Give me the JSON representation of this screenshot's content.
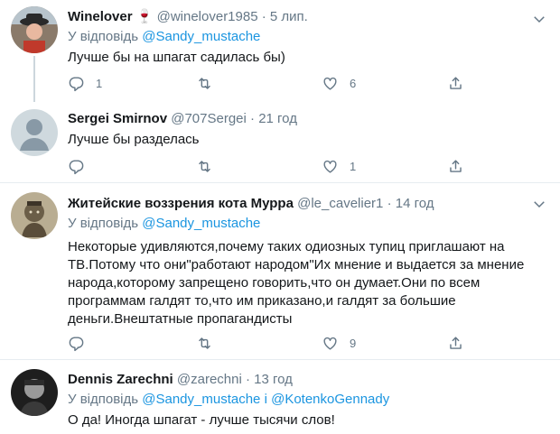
{
  "tweets": [
    {
      "name": "Winelover",
      "name_emoji": "🍷",
      "handle": "@winelover1985",
      "dot": "·",
      "time": "5 лип.",
      "reply_prefix": "У відповідь",
      "mentions": [
        "@Sandy_mustache"
      ],
      "mention_joiner": "",
      "text": "Лучше бы на шпагат садилась бы)",
      "counts": {
        "reply": "1",
        "retweet": "",
        "like": "6"
      }
    },
    {
      "name": "Sergei Smirnov",
      "handle": "@707Sergei",
      "dot": "·",
      "time": "21 год",
      "text": "Лучше бы разделась",
      "counts": {
        "reply": "",
        "retweet": "",
        "like": "1"
      }
    },
    {
      "name": "Житейские воззрения кота Мурра",
      "handle": "@le_cavelier1",
      "dot": "·",
      "time": "14 год",
      "reply_prefix": "У відповідь",
      "mentions": [
        "@Sandy_mustache"
      ],
      "mention_joiner": "",
      "text_lines": [
        "Некоторые удивляются,почему таких одиозных тупиц приглашают на",
        "ТВ.Потому что они\"работают народом\"Их мнение и выдается за мнение",
        "народа,которому запрещено говорить,что он думает.Они по всем",
        "программам галдят то,что им приказано,и галдят за большие",
        "деньги.Внештатные пропагандисты"
      ],
      "counts": {
        "reply": "",
        "retweet": "",
        "like": "9"
      }
    },
    {
      "name": "Dennis Zarechni",
      "handle": "@zarechni",
      "dot": "·",
      "time": "13 год",
      "reply_prefix": "У відповідь",
      "mentions": [
        "@Sandy_mustache",
        "@KotenkoGennady"
      ],
      "mention_joiner": "і",
      "text": "О да! Иногда шпагат - лучше тысячи слов!"
    }
  ],
  "colors": {
    "link": "#1b95e0",
    "muted": "#657786",
    "text": "#14171a",
    "separator": "#e6ecf0"
  },
  "icons": [
    "reply-icon",
    "retweet-icon",
    "like-icon",
    "share-icon",
    "chevron-down-icon",
    "wine-glass-icon"
  ]
}
